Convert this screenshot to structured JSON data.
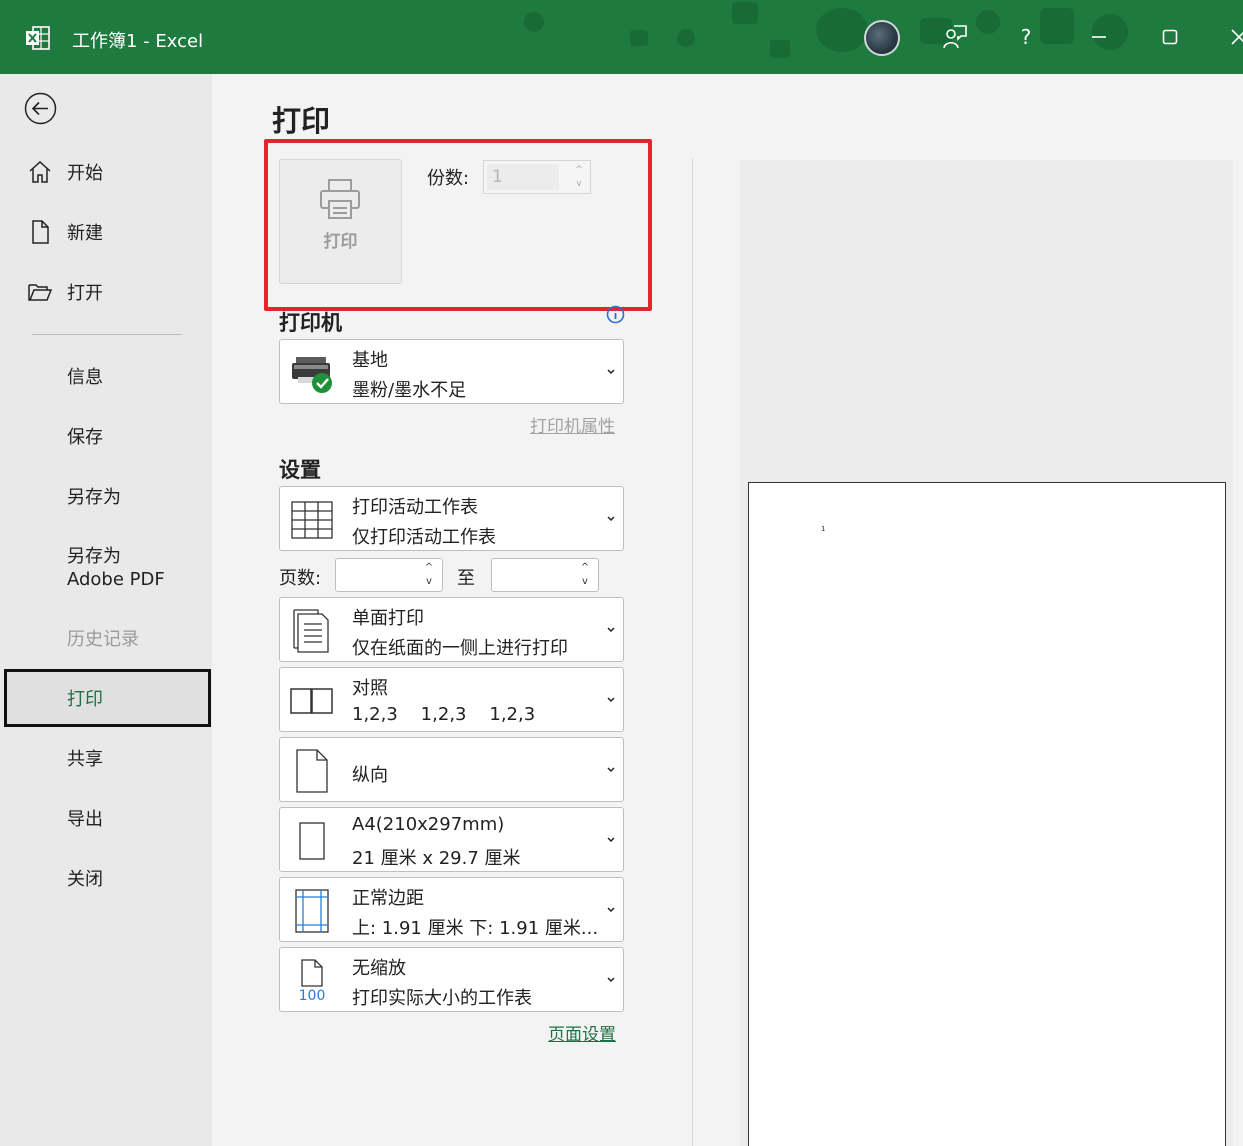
{
  "window": {
    "title": "工作簿1  -  Excel",
    "help_label": "?",
    "accent_color": "#1e7a3e"
  },
  "sidebar": {
    "items": [
      {
        "label": "开始",
        "icon": "home-icon"
      },
      {
        "label": "新建",
        "icon": "new-file-icon"
      },
      {
        "label": "打开",
        "icon": "open-folder-icon"
      },
      {
        "label": "信息"
      },
      {
        "label": "保存"
      },
      {
        "label": "另存为"
      },
      {
        "label": "另存为\nAdobe PDF"
      },
      {
        "label": "历史记录",
        "disabled": true
      },
      {
        "label": "打印",
        "active": true
      },
      {
        "label": "共享"
      },
      {
        "label": "导出"
      },
      {
        "label": "关闭"
      }
    ]
  },
  "main": {
    "title": "打印",
    "print_button_label": "打印",
    "copies_label": "份数:",
    "copies_value": "1",
    "printer_section": "打印机",
    "printer": {
      "name": "基地",
      "status": "墨粉/墨水不足"
    },
    "printer_properties_link": "打印机属性",
    "settings_section": "设置",
    "settings": [
      {
        "line1": "打印活动工作表",
        "line2": "仅打印活动工作表",
        "icon": "sheet-grid-icon"
      },
      {
        "line1": "单面打印",
        "line2": "仅在纸面的一侧上进行打印",
        "icon": "one-sided-icon"
      },
      {
        "line1": "对照",
        "line2": "1,2,3    1,2,3    1,2,3",
        "icon": "collated-icon"
      },
      {
        "line1": "纵向",
        "line2": "",
        "icon": "portrait-icon"
      },
      {
        "line1": "A4(210x297mm)",
        "line2": "21 厘米 x 29.7 厘米",
        "icon": "paper-size-icon"
      },
      {
        "line1": "正常边距",
        "line2": "上: 1.91 厘米 下: 1.91 厘米...",
        "icon": "margins-icon"
      },
      {
        "line1": "无缩放",
        "line2": "打印实际大小的工作表",
        "icon": "no-scaling-icon",
        "icon_text": "100"
      }
    ],
    "pages_label": "页数:",
    "pages_to_label": "至",
    "page_setup_link": "页面设置"
  },
  "preview": {
    "page_number": "1"
  }
}
